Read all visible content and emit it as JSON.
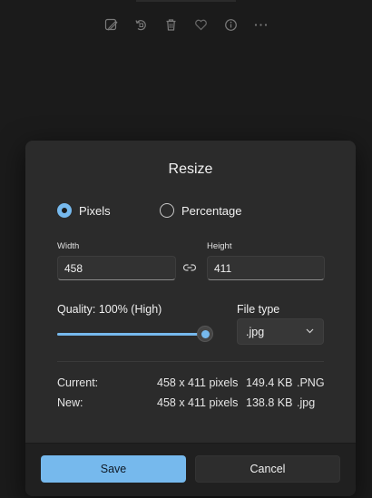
{
  "toolbar": {
    "icons": [
      "edit-image-icon",
      "rotate-icon",
      "delete-icon",
      "favorite-icon",
      "info-icon",
      "more-icon"
    ]
  },
  "dialog": {
    "title": "Resize",
    "mode": {
      "options": [
        {
          "label": "Pixels",
          "selected": true
        },
        {
          "label": "Percentage",
          "selected": false
        }
      ]
    },
    "width": {
      "label": "Width",
      "value": "458"
    },
    "height": {
      "label": "Height",
      "value": "411"
    },
    "aspect_lock_icon": "link-icon",
    "quality": {
      "label": "Quality: 100% (High)",
      "percent": 100
    },
    "file_type": {
      "label": "File type",
      "value": ".jpg"
    },
    "info": {
      "current": {
        "label": "Current:",
        "dimensions": "458 x 411 pixels",
        "size": "149.4 KB",
        "type": ".PNG"
      },
      "new": {
        "label": "New:",
        "dimensions": "458 x 411 pixels",
        "size": "138.8 KB",
        "type": ".jpg"
      }
    },
    "buttons": {
      "save": "Save",
      "cancel": "Cancel"
    }
  },
  "colors": {
    "accent": "#76b9ed",
    "dialog_bg": "#2b2b2b",
    "footer_bg": "#202020",
    "page_bg": "#1b1b1b"
  }
}
